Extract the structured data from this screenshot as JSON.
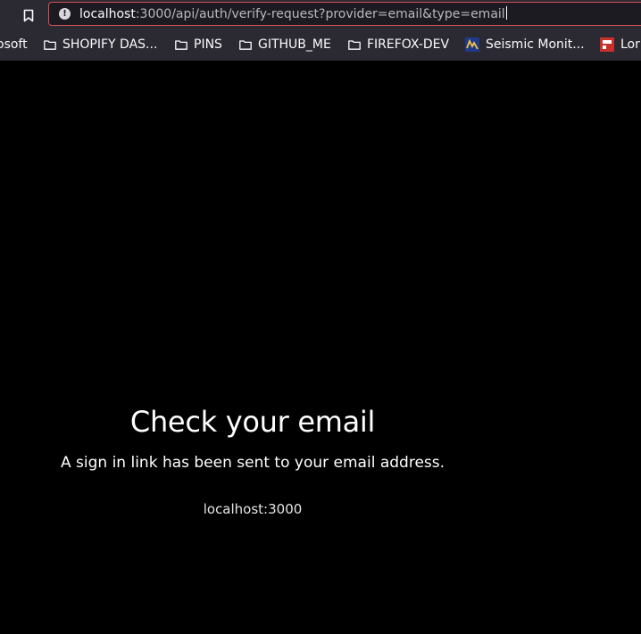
{
  "browser": {
    "url_host": "localhost",
    "url_path": ":3000/api/auth/verify-request?provider=email&type=email",
    "bookmarks": [
      {
        "label": "osoft",
        "icon": "none"
      },
      {
        "label": "SHOPIFY DAS...",
        "icon": "folder-icon"
      },
      {
        "label": "PINS",
        "icon": "folder-icon"
      },
      {
        "label": "GITHUB_ME",
        "icon": "folder-icon"
      },
      {
        "label": "FIREFOX-DEV",
        "icon": "folder-icon"
      },
      {
        "label": "Seismic Monit...",
        "icon": "seismic-site-icon"
      },
      {
        "label": "Lor",
        "icon": "red-site-icon"
      }
    ]
  },
  "page": {
    "heading": "Check your email",
    "message": "A sign in link has been sent to your email address.",
    "site_link": "localhost:3000"
  },
  "colors": {
    "background": "#000000",
    "chrome": "#2b2a33",
    "url_bar_focus_border": "#d74f52",
    "text": "#ffffff"
  }
}
